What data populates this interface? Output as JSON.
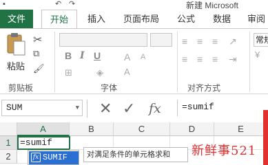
{
  "window": {
    "title": "新建 Microsoft"
  },
  "tabs": [
    {
      "label": "文件"
    },
    {
      "label": "开始"
    },
    {
      "label": "插入"
    },
    {
      "label": "页面布局"
    },
    {
      "label": "公式"
    },
    {
      "label": "数据"
    },
    {
      "label": "审阅"
    }
  ],
  "ribbon": {
    "paste_label": "粘贴",
    "groups": {
      "clipboard": "剪贴板",
      "font": "字体",
      "alignment": "对齐方式",
      "number": "常规"
    }
  },
  "formula_bar": {
    "name_box": "SUM",
    "fx_label": "fx",
    "formula": "=sumif"
  },
  "grid": {
    "columns": [
      "A",
      "B",
      "C",
      "D",
      "E"
    ],
    "rows": [
      "1",
      "2"
    ],
    "active_cell_value": "=sumif"
  },
  "autocomplete": {
    "item": "SUMIF",
    "tooltip": "对满足条件的单元格求和"
  },
  "watermark": "新鲜事521",
  "colors": {
    "accent": "#217346",
    "highlight": "#2a6fd1",
    "watermark": "#e23030"
  }
}
